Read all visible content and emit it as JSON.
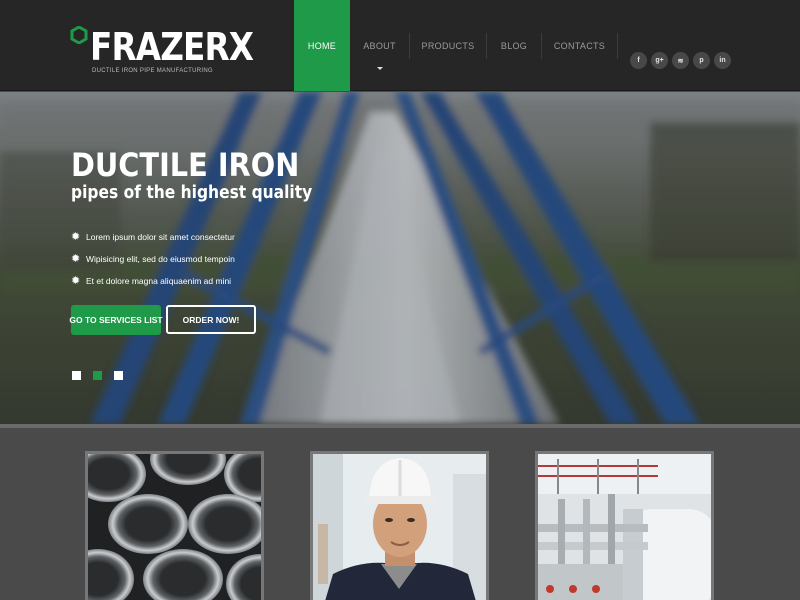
{
  "brand": {
    "name": "FRAZERX",
    "tagline": "DUCTILE IRON PIPE MANUFACTURING",
    "accent_color": "#1f9a48"
  },
  "nav": {
    "items": [
      {
        "label": "HOME",
        "active": true
      },
      {
        "label": "ABOUT",
        "active": false,
        "has_dropdown": true
      },
      {
        "label": "PRODUCTS",
        "active": false
      },
      {
        "label": "BLOG",
        "active": false
      },
      {
        "label": "CONTACTS",
        "active": false
      }
    ]
  },
  "social": [
    {
      "icon": "facebook-icon",
      "glyph": "f"
    },
    {
      "icon": "google-plus-icon",
      "glyph": "g+"
    },
    {
      "icon": "rss-icon",
      "glyph": "≋"
    },
    {
      "icon": "pinterest-icon",
      "glyph": "p"
    },
    {
      "icon": "linkedin-icon",
      "glyph": "in"
    }
  ],
  "hero": {
    "title": "DUCTILE IRON",
    "subtitle": "pipes of the highest quality",
    "features": [
      "Lorem ipsum dolor sit amet consectetur",
      "Wipisicing elit, sed do eiusmod tempoin",
      "Et et dolore magna aliquaenim ad mini"
    ],
    "primary_button": "GO TO SERVICES LIST",
    "secondary_button": "ORDER NOW!",
    "slides": 3,
    "active_slide": 2
  },
  "cards": [
    {
      "image": "steel-pipes-photo"
    },
    {
      "image": "worker-hard-hat-photo"
    },
    {
      "image": "industrial-tanks-photo"
    }
  ]
}
